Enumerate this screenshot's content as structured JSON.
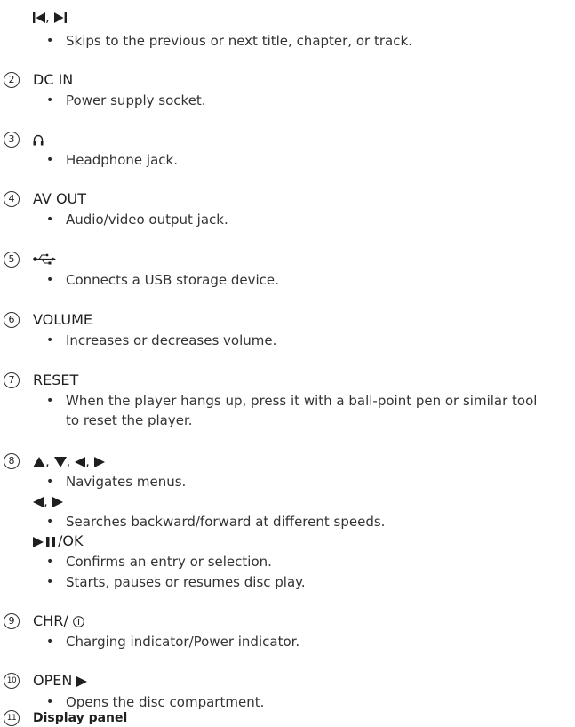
{
  "items": {
    "prev_next": {
      "heading": ", ",
      "description": "Skips to the previous or next title, chapter, or track."
    },
    "item2": {
      "number": "2",
      "heading": "DC IN",
      "description": "Power supply socket."
    },
    "item3": {
      "number": "3",
      "heading_icon": "headphone-icon",
      "description": "Headphone jack."
    },
    "item4": {
      "number": "4",
      "heading": "AV OUT",
      "description": "Audio/video output jack."
    },
    "item5": {
      "number": "5",
      "heading_icon": "usb-icon",
      "description": "Connects a USB storage device."
    },
    "item6": {
      "number": "6",
      "heading": "VOLUME",
      "description": "Increases or decreases volume."
    },
    "item7": {
      "number": "7",
      "heading": "RESET",
      "description_line1": "When the player hangs up, press it with a ball-point pen or similar tool",
      "description_line2": "to reset the player."
    },
    "item8": {
      "number": "8",
      "heading_sep": ", ",
      "description_nav": "Navigates menus.",
      "sub_heading_sep": ", ",
      "description_search": "Searches backward/forward at different speeds.",
      "ok_label": "/OK",
      "description_confirm": "Confirms an entry or selection.",
      "description_play": "Starts, pauses or resumes disc play."
    },
    "item9": {
      "number": "9",
      "heading": "CHR/ ",
      "description": "Charging indicator/Power indicator."
    },
    "item10": {
      "number": "10",
      "heading": "OPEN ",
      "description": "Opens the disc compartment."
    },
    "item11": {
      "number": "11",
      "heading": "Display panel"
    }
  },
  "bullet_glyph": "•"
}
